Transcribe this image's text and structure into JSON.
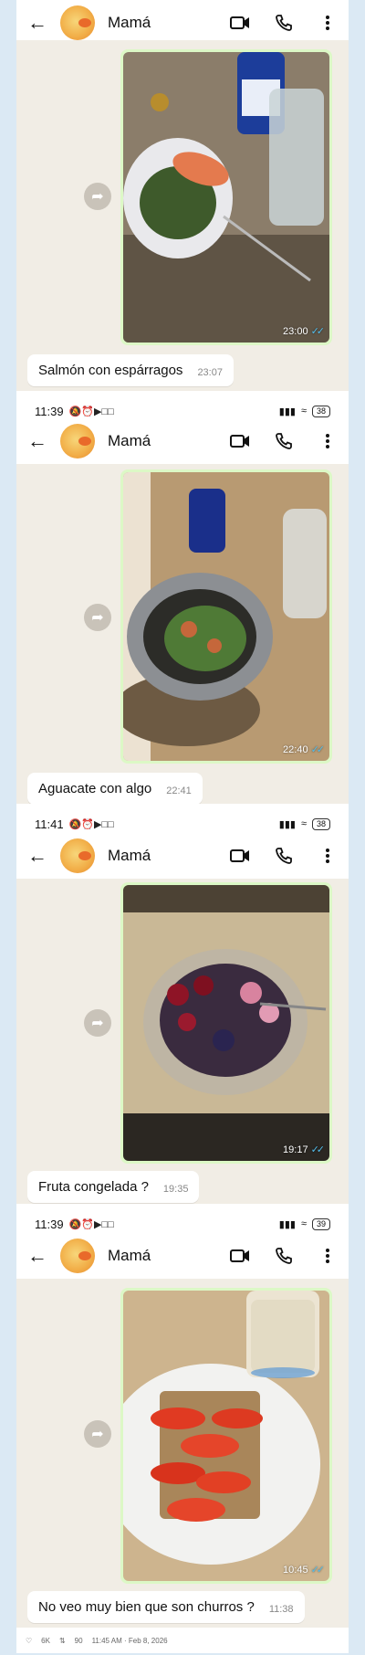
{
  "contact": {
    "name": "Mamá"
  },
  "screens": [
    {
      "status": null,
      "photo_time": "23:00",
      "caption": "Salmón con espárragos",
      "caption_time": "23:07"
    },
    {
      "status": {
        "time": "11:39",
        "battery": "38"
      },
      "photo_time": "22:40",
      "caption": "Aguacate con algo",
      "caption_time": "22:41"
    },
    {
      "status": {
        "time": "11:41",
        "battery": "38"
      },
      "photo_time": "19:17",
      "caption": "Fruta congelada ?",
      "caption_time": "19:35"
    },
    {
      "status": {
        "time": "11:39",
        "battery": "39"
      },
      "photo_time": "10:45",
      "caption": "No veo muy bien que son churros ?",
      "caption_time": "11:38"
    }
  ],
  "footer": {
    "likes": "6K",
    "reposts": "90",
    "timestamp": "11:45 AM · Feb 8, 2026"
  },
  "colors": {
    "chat_bg": "#f1ede5",
    "outgoing_bubble": "#dcf8c6",
    "read_ticks": "#53bdeb",
    "page_bg": "#dbe9f4"
  }
}
